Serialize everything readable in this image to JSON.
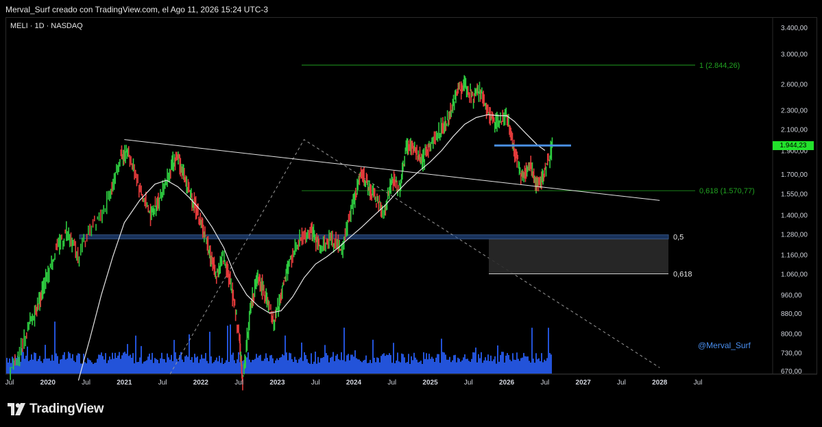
{
  "header": {
    "attribution": "Merval_Surf creado con TradingView.com, el Ago 11, 2026 15:24 UTC-3"
  },
  "symbol": {
    "label": "MELI · 1D · NASDAQ"
  },
  "watermark": "@Merval_Surf",
  "footer": {
    "brand": "TradingView"
  },
  "colors": {
    "up": "#26a69a",
    "down": "#ef5350",
    "volume": "#2962ff",
    "fib": "#21a121",
    "ma": "#e6e6e6",
    "zone": "#4a7fd4",
    "price_tag": "#22e22b"
  },
  "chart_data": {
    "type": "line",
    "title": "",
    "y_scale": "log",
    "y_ticks": [
      "3.400,00",
      "3.000,00",
      "2.600,00",
      "2.300,00",
      "2.100,00",
      "1.900,00",
      "1.700,00",
      "1.550,00",
      "1.400,00",
      "1.280,00",
      "1.160,00",
      "1.060,00",
      "960,00",
      "880,00",
      "800,00",
      "730,00",
      "670,00"
    ],
    "y_tick_values": [
      3400,
      3000,
      2600,
      2300,
      2100,
      1900,
      1700,
      1550,
      1400,
      1280,
      1160,
      1060,
      960,
      880,
      800,
      730,
      670
    ],
    "ylim": [
      660,
      3500
    ],
    "x_ticks": [
      "Jul",
      "2020",
      "Jul",
      "2021",
      "Jul",
      "2022",
      "Jul",
      "2023",
      "Jul",
      "2024",
      "Jul",
      "2025",
      "Jul",
      "2026",
      "Jul",
      "2027",
      "Jul",
      "2028",
      "Jul"
    ],
    "x_tick_dates": [
      2019.5,
      2020.0,
      2020.5,
      2021.0,
      2021.5,
      2022.0,
      2022.5,
      2023.0,
      2023.5,
      2024.0,
      2024.5,
      2025.0,
      2025.5,
      2026.0,
      2026.5,
      2027.0,
      2027.5,
      2028.0,
      2028.5
    ],
    "price_series": [
      [
        2019.5,
        650
      ],
      [
        2019.7,
        780
      ],
      [
        2019.85,
        900
      ],
      [
        2019.95,
        1000
      ],
      [
        2020.1,
        1180
      ],
      [
        2020.25,
        1300
      ],
      [
        2020.4,
        1150
      ],
      [
        2020.6,
        1350
      ],
      [
        2020.8,
        1500
      ],
      [
        2020.95,
        1850
      ],
      [
        2021.05,
        1900
      ],
      [
        2021.2,
        1600
      ],
      [
        2021.35,
        1400
      ],
      [
        2021.45,
        1500
      ],
      [
        2021.6,
        1750
      ],
      [
        2021.7,
        1850
      ],
      [
        2021.8,
        1650
      ],
      [
        2021.9,
        1500
      ],
      [
        2022.0,
        1350
      ],
      [
        2022.1,
        1200
      ],
      [
        2022.2,
        1050
      ],
      [
        2022.3,
        1150
      ],
      [
        2022.4,
        1000
      ],
      [
        2022.5,
        800
      ],
      [
        2022.55,
        640
      ],
      [
        2022.65,
        900
      ],
      [
        2022.75,
        1050
      ],
      [
        2022.85,
        950
      ],
      [
        2022.95,
        840
      ],
      [
        2023.05,
        950
      ],
      [
        2023.15,
        1100
      ],
      [
        2023.3,
        1250
      ],
      [
        2023.45,
        1300
      ],
      [
        2023.55,
        1200
      ],
      [
        2023.7,
        1250
      ],
      [
        2023.85,
        1200
      ],
      [
        2024.0,
        1500
      ],
      [
        2024.1,
        1700
      ],
      [
        2024.2,
        1600
      ],
      [
        2024.3,
        1500
      ],
      [
        2024.4,
        1400
      ],
      [
        2024.5,
        1650
      ],
      [
        2024.6,
        1600
      ],
      [
        2024.7,
        1950
      ],
      [
        2024.8,
        1900
      ],
      [
        2024.9,
        1800
      ],
      [
        2025.0,
        1950
      ],
      [
        2025.15,
        2100
      ],
      [
        2025.25,
        2250
      ],
      [
        2025.35,
        2500
      ],
      [
        2025.45,
        2600
      ],
      [
        2025.55,
        2450
      ],
      [
        2025.65,
        2500
      ],
      [
        2025.75,
        2300
      ],
      [
        2025.85,
        2150
      ],
      [
        2026.0,
        2250
      ],
      [
        2026.1,
        1900
      ],
      [
        2026.2,
        1650
      ],
      [
        2026.3,
        1780
      ],
      [
        2026.4,
        1600
      ],
      [
        2026.5,
        1700
      ],
      [
        2026.6,
        1944
      ]
    ],
    "moving_average": [
      [
        2020.4,
        640
      ],
      [
        2020.55,
        780
      ],
      [
        2020.7,
        960
      ],
      [
        2020.85,
        1150
      ],
      [
        2021.0,
        1350
      ],
      [
        2021.2,
        1500
      ],
      [
        2021.4,
        1620
      ],
      [
        2021.55,
        1650
      ],
      [
        2021.7,
        1600
      ],
      [
        2021.85,
        1520
      ],
      [
        2022.0,
        1430
      ],
      [
        2022.15,
        1320
      ],
      [
        2022.3,
        1200
      ],
      [
        2022.45,
        1050
      ],
      [
        2022.6,
        960
      ],
      [
        2022.75,
        910
      ],
      [
        2022.9,
        880
      ],
      [
        2023.05,
        890
      ],
      [
        2023.2,
        950
      ],
      [
        2023.35,
        1040
      ],
      [
        2023.5,
        1110
      ],
      [
        2023.65,
        1150
      ],
      [
        2023.8,
        1200
      ],
      [
        2023.95,
        1260
      ],
      [
        2024.1,
        1320
      ],
      [
        2024.25,
        1390
      ],
      [
        2024.4,
        1460
      ],
      [
        2024.55,
        1550
      ],
      [
        2024.7,
        1640
      ],
      [
        2024.85,
        1720
      ],
      [
        2025.0,
        1800
      ],
      [
        2025.15,
        1900
      ],
      [
        2025.3,
        2030
      ],
      [
        2025.45,
        2150
      ],
      [
        2025.6,
        2220
      ],
      [
        2025.75,
        2250
      ],
      [
        2025.9,
        2240
      ],
      [
        2026.0,
        2240
      ],
      [
        2026.1,
        2180
      ],
      [
        2026.25,
        2060
      ],
      [
        2026.4,
        1950
      ],
      [
        2026.5,
        1900
      ]
    ],
    "volume_series_note": "",
    "annotations": {
      "fib_level_1": "1 (2.844,26)",
      "fib_level_0618": "0,618 (1.570,77)",
      "zone_label_05": "0,5",
      "zone_label_0618": "0,618",
      "last_price": "1.944,23"
    },
    "levels": {
      "fib_1": 2844.26,
      "fib_0618": 1570.77,
      "zone_05_top": 1275,
      "zone_05_bottom": 1250,
      "box_bottom": 1060,
      "resistance_box": 1945
    },
    "trendline": [
      [
        2021.0,
        2000
      ],
      [
        2028.0,
        1500
      ]
    ],
    "dashed_lines": [
      [
        [
          2021.6,
          660
        ],
        [
          2023.35,
          2000
        ],
        [
          2028.0,
          680
        ]
      ]
    ],
    "grid": false,
    "legend": "none"
  }
}
